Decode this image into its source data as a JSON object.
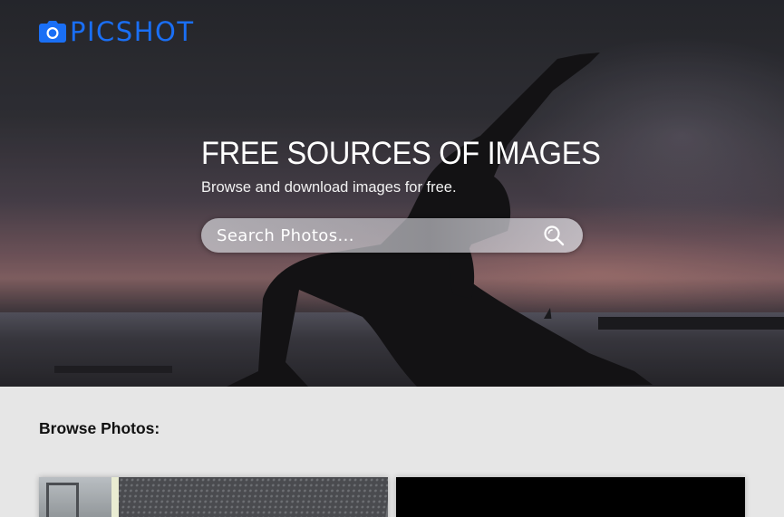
{
  "header": {
    "logo_text": "PICSHOT",
    "logo_icon": "camera-icon",
    "brand_color": "#1a6ff5"
  },
  "hero": {
    "title": "FREE SOURCES OF IMAGES",
    "subtitle": "Browse and download images for free.",
    "search": {
      "placeholder": "Search Photos...",
      "value": "",
      "icon": "search-icon"
    }
  },
  "browse": {
    "title": "Browse Photos:",
    "photos": [
      {
        "id": "photo-1"
      },
      {
        "id": "photo-2"
      }
    ]
  }
}
